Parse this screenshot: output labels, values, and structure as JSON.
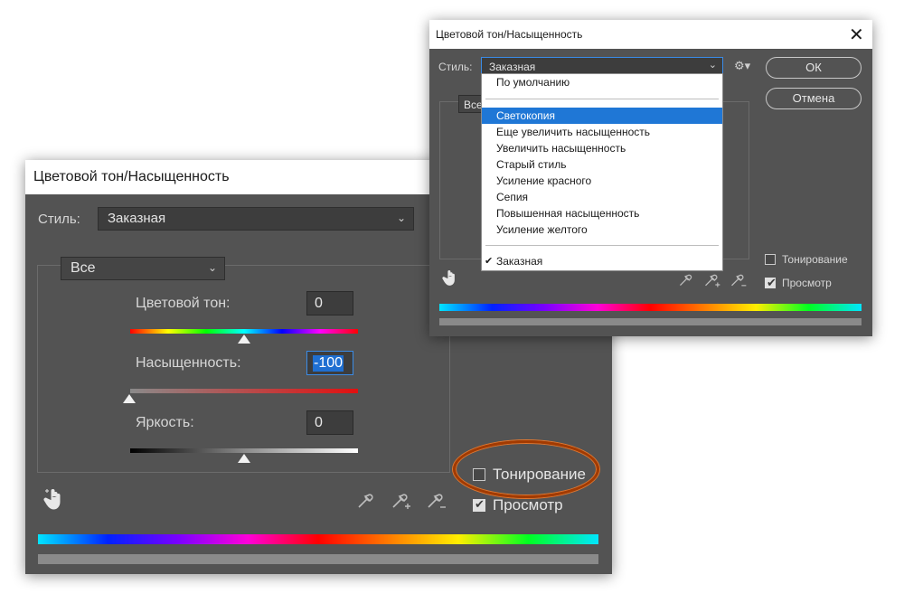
{
  "back_dialog": {
    "title": "Цветовой тон/Насыщенность",
    "style_label": "Стиль:",
    "style_value": "Заказная",
    "channel_value": "Все",
    "hue_label": "Цветовой тон:",
    "hue_value": "0",
    "saturation_label": "Насыщенность:",
    "saturation_value": "-100",
    "lightness_label": "Яркость:",
    "lightness_value": "0",
    "colorize_label": "Тонирование",
    "preview_label": "Просмотр",
    "colorize_checked": false,
    "preview_checked": true,
    "sliders": {
      "hue": 0,
      "saturation": -100,
      "lightness": 0,
      "range": [
        -100,
        100
      ]
    }
  },
  "front_dialog": {
    "title": "Цветовой тон/Насыщенность",
    "style_label": "Стиль:",
    "style_value": "Заказная",
    "channel_value": "Все",
    "ok_label": "ОК",
    "cancel_label": "Отмена",
    "colorize_label": "Тонирование",
    "preview_label": "Просмотр",
    "colorize_checked": false,
    "preview_checked": true,
    "dropdown": {
      "default_item": "По умолчанию",
      "presets": [
        "Светокопия",
        "Еще увеличить насыщенность",
        "Увеличить насыщенность",
        "Старый стиль",
        "Усиление красного",
        "Сепия",
        "Повышенная насыщенность",
        "Усиление желтого"
      ],
      "selected_preset": "Светокопия",
      "custom_item": "Заказная",
      "checked_item": "Заказная"
    }
  },
  "icons": [
    "hand-target-icon",
    "eyedropper-icon",
    "eyedropper-plus-icon",
    "eyedropper-minus-icon",
    "gear-icon",
    "close-icon",
    "chevron-down-icon",
    "checkmark-icon"
  ],
  "colors": {
    "dialog_bg": "#535353",
    "field_bg": "#3d3d3d",
    "highlight": "#1f77d6",
    "ring": "#a33a00"
  }
}
